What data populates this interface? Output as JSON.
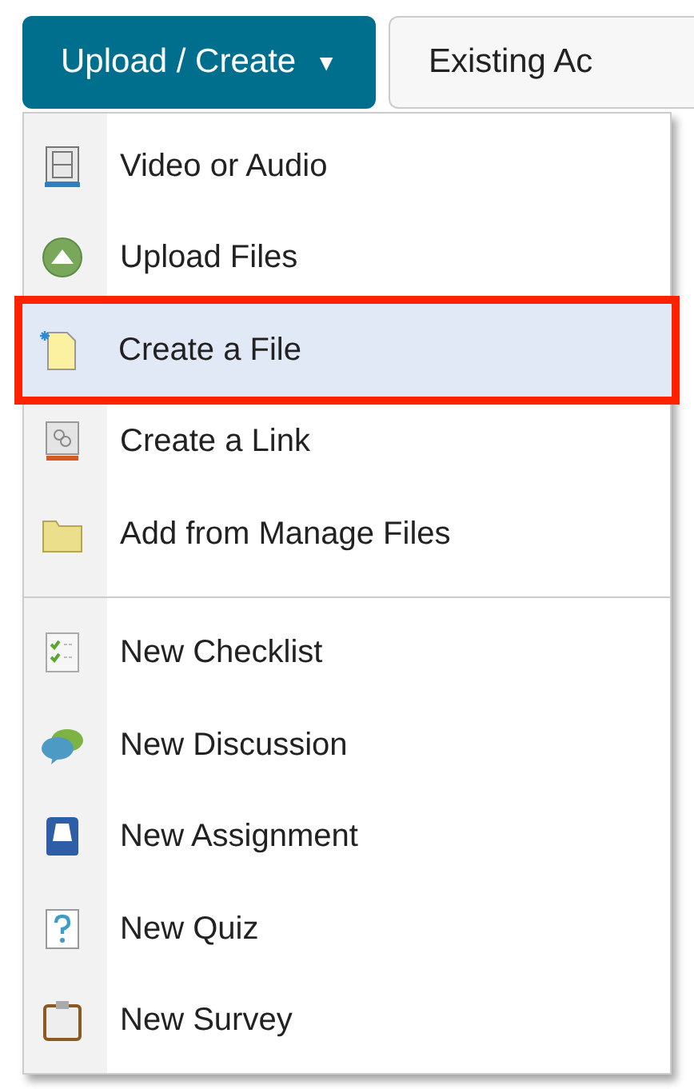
{
  "toolbar": {
    "primary_button": {
      "label": "Upload / Create",
      "caret": "▼",
      "expanded": true
    },
    "secondary_button": {
      "label": "Existing Ac"
    }
  },
  "menu": {
    "groups": [
      {
        "items": [
          {
            "kind": "media",
            "label": "Video or Audio",
            "selected": false
          },
          {
            "kind": "upload",
            "label": "Upload Files",
            "selected": false
          },
          {
            "kind": "file",
            "label": "Create a File",
            "selected": true
          },
          {
            "kind": "link",
            "label": "Create a Link",
            "selected": false
          },
          {
            "kind": "folder",
            "label": "Add from Manage Files",
            "selected": false
          }
        ]
      },
      {
        "items": [
          {
            "kind": "checklist",
            "label": "New Checklist",
            "selected": false
          },
          {
            "kind": "discussion",
            "label": "New Discussion",
            "selected": false
          },
          {
            "kind": "assignment",
            "label": "New Assignment",
            "selected": false
          },
          {
            "kind": "quiz",
            "label": "New Quiz",
            "selected": false
          },
          {
            "kind": "survey",
            "label": "New Survey",
            "selected": false
          }
        ]
      }
    ]
  }
}
